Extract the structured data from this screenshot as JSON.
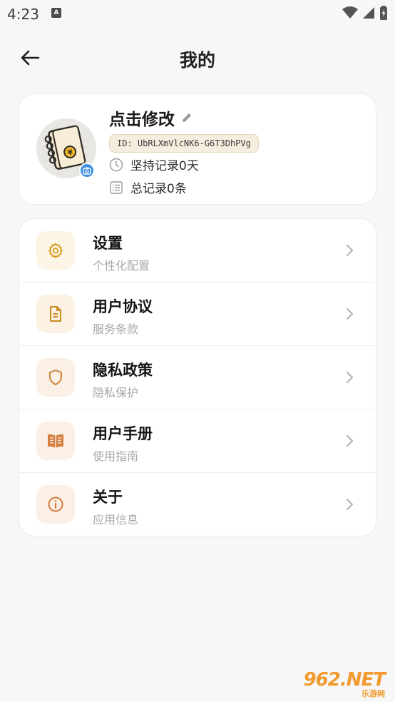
{
  "status_bar": {
    "time": "4:23",
    "app_icon_letter": "A"
  },
  "header": {
    "title": "我的"
  },
  "profile": {
    "nickname": "点击修改",
    "id_label": "ID: UbRLXmVlcNK6-G6T3DhPVg",
    "days_label": "坚持记录0天",
    "records_label": "总记录0条"
  },
  "menu": {
    "items": [
      {
        "title": "设置",
        "subtitle": "个性化配置",
        "icon": "gear-icon",
        "bg": "#fcf4e4",
        "fg": "#d89a22"
      },
      {
        "title": "用户协议",
        "subtitle": "服务条款",
        "icon": "document-icon",
        "bg": "#fbf2e3",
        "fg": "#c98a1f"
      },
      {
        "title": "隐私政策",
        "subtitle": "隐私保护",
        "icon": "shield-icon",
        "bg": "#fbf0e5",
        "fg": "#d2833a"
      },
      {
        "title": "用户手册",
        "subtitle": "使用指南",
        "icon": "book-icon",
        "bg": "#fbefe6",
        "fg": "#d58042"
      },
      {
        "title": "关于",
        "subtitle": "应用信息",
        "icon": "info-icon",
        "bg": "#fbefe6",
        "fg": "#d57a3c"
      }
    ]
  },
  "watermark": {
    "main": "962.NET",
    "sub": "乐游网"
  },
  "colors": {
    "background": "#f7f7f8",
    "card": "#ffffff",
    "id_tag_bg": "#f5eedf",
    "badge_blue": "#3d8fe0"
  }
}
